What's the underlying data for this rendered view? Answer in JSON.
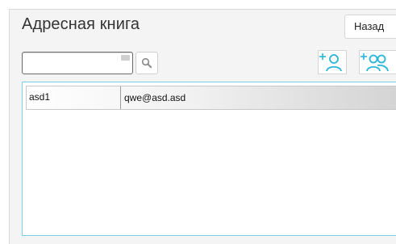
{
  "header": {
    "title": "Адресная книга",
    "back_label": "Назад"
  },
  "search": {
    "value": "",
    "placeholder": ""
  },
  "icons": {
    "search": "magnifier-icon",
    "add_contact": "add-person-icon",
    "add_group": "add-group-icon",
    "accent": "#29b5d9"
  },
  "contacts": [
    {
      "name": "asd1",
      "email": "qwe@asd.asd"
    }
  ]
}
